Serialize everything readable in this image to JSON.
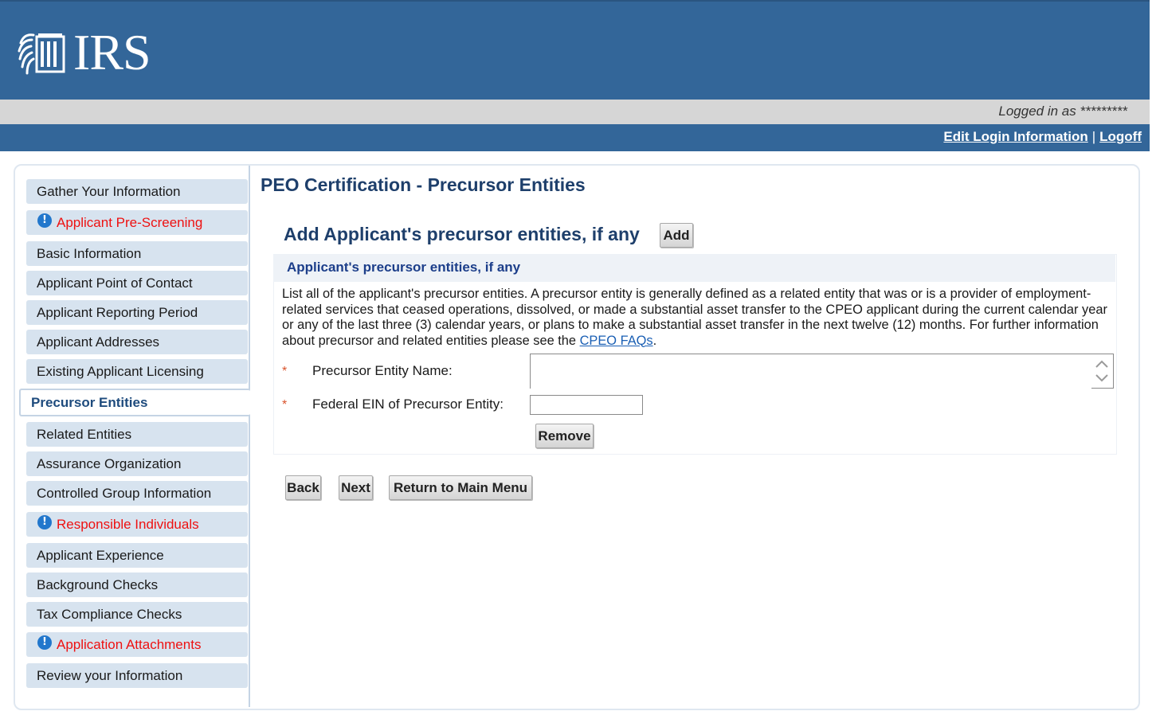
{
  "header": {
    "logo_text": "IRS",
    "logged_in_text": "Logged in as *********",
    "links": {
      "edit_login": "Edit Login Information",
      "separator": "|",
      "logoff": "Logoff"
    }
  },
  "sidebar": {
    "items": [
      {
        "label": "Gather Your Information",
        "state": "normal"
      },
      {
        "label": "Applicant Pre-Screening",
        "state": "warning"
      },
      {
        "label": "Basic Information",
        "state": "normal"
      },
      {
        "label": "Applicant Point of Contact",
        "state": "normal"
      },
      {
        "label": "Applicant Reporting Period",
        "state": "normal"
      },
      {
        "label": "Applicant Addresses",
        "state": "normal"
      },
      {
        "label": "Existing Applicant Licensing",
        "state": "normal"
      },
      {
        "label": "Precursor Entities",
        "state": "active"
      },
      {
        "label": "Related Entities",
        "state": "normal"
      },
      {
        "label": "Assurance Organization",
        "state": "normal"
      },
      {
        "label": "Controlled Group Information",
        "state": "normal"
      },
      {
        "label": "Responsible Individuals",
        "state": "warning"
      },
      {
        "label": "Applicant Experience",
        "state": "normal"
      },
      {
        "label": "Background Checks",
        "state": "normal"
      },
      {
        "label": "Tax Compliance Checks",
        "state": "normal"
      },
      {
        "label": "Application Attachments",
        "state": "warning"
      },
      {
        "label": "Review your Information",
        "state": "normal"
      }
    ],
    "warning_icon": "info-circle-icon"
  },
  "main": {
    "title": "PEO Certification - Precursor Entities",
    "add_heading": "Add Applicant's precursor entities, if any",
    "add_button": "Add",
    "panel": {
      "heading": "Applicant's precursor entities, if any",
      "description": "List all of the applicant's precursor entities. A precursor entity is generally defined as a related entity that was or is a provider of employment-related services that ceased operations, dissolved, or made a substantial asset transfer to the CPEO applicant during the current calendar year or any of the last three (3) calendar years, or plans to make a substantial asset transfer in the next twelve (12) months. For further information about precursor and related entities please see the ",
      "faq_link": "CPEO FAQs",
      "description_end": ".",
      "required_marker": "*",
      "fields": {
        "name_label": "Precursor Entity Name:",
        "name_value": "",
        "ein_label": "Federal EIN of Precursor Entity:",
        "ein_value": ""
      },
      "remove_button": "Remove"
    },
    "nav_buttons": {
      "back": "Back",
      "next": "Next",
      "main_menu": "Return to Main Menu"
    }
  },
  "colors": {
    "header_blue": "#336699",
    "title_navy": "#1e3f6b",
    "warning_red": "#ee1111",
    "nav_bg": "#d7e3ef"
  }
}
